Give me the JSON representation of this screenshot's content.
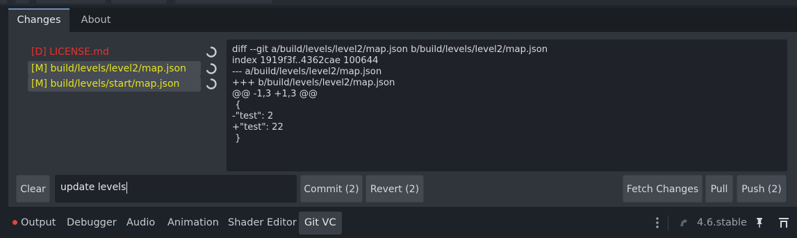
{
  "panel": {
    "tabs": [
      {
        "label": "Changes",
        "active": true
      },
      {
        "label": "About",
        "active": false
      }
    ]
  },
  "files": [
    {
      "label": "[D] LICENSE.md",
      "status": "deleted",
      "color": "#e8322e",
      "selected": false,
      "icon": "revert-icon"
    },
    {
      "label": "[M] build/levels/level2/map.json",
      "status": "modified",
      "color": "#e3e31e",
      "selected": true,
      "icon": "revert-icon"
    },
    {
      "label": "[M] build/levels/start/map.json",
      "status": "modified",
      "color": "#e3e31e",
      "selected": true,
      "icon": "revert-icon"
    }
  ],
  "diff": {
    "lines": [
      "diff --git a/build/levels/level2/map.json b/build/levels/level2/map.json",
      "index 1919f3f..4362cae 100644",
      "--- a/build/levels/level2/map.json",
      "+++ b/build/levels/level2/map.json",
      "@@ -1,3 +1,3 @@",
      " {",
      "-\"test\": 2",
      "+\"test\": 22",
      " }"
    ]
  },
  "actions": {
    "clear_label": "Clear",
    "commit_message": "update levels",
    "commit_label": "Commit (2)",
    "revert_label": "Revert (2)",
    "fetch_label": "Fetch Changes",
    "pull_label": "Pull",
    "push_label": "Push (2)"
  },
  "bottom": {
    "tabs": [
      {
        "label": "Output",
        "has_dot": true,
        "dot_color": "#e0473d"
      },
      {
        "label": "Debugger"
      },
      {
        "label": "Audio"
      },
      {
        "label": "Animation"
      },
      {
        "label": "Shader Editor"
      },
      {
        "label": "Git VC",
        "active": true
      }
    ],
    "version": "4.6.stable",
    "icons": [
      "kebab-menu-icon",
      "update-spinner-icon",
      "pin-icon",
      "expand-panel-icon"
    ]
  },
  "colors": {
    "accent": "#6f8fb8",
    "deleted": "#e8322e",
    "modified": "#e3e31e"
  }
}
